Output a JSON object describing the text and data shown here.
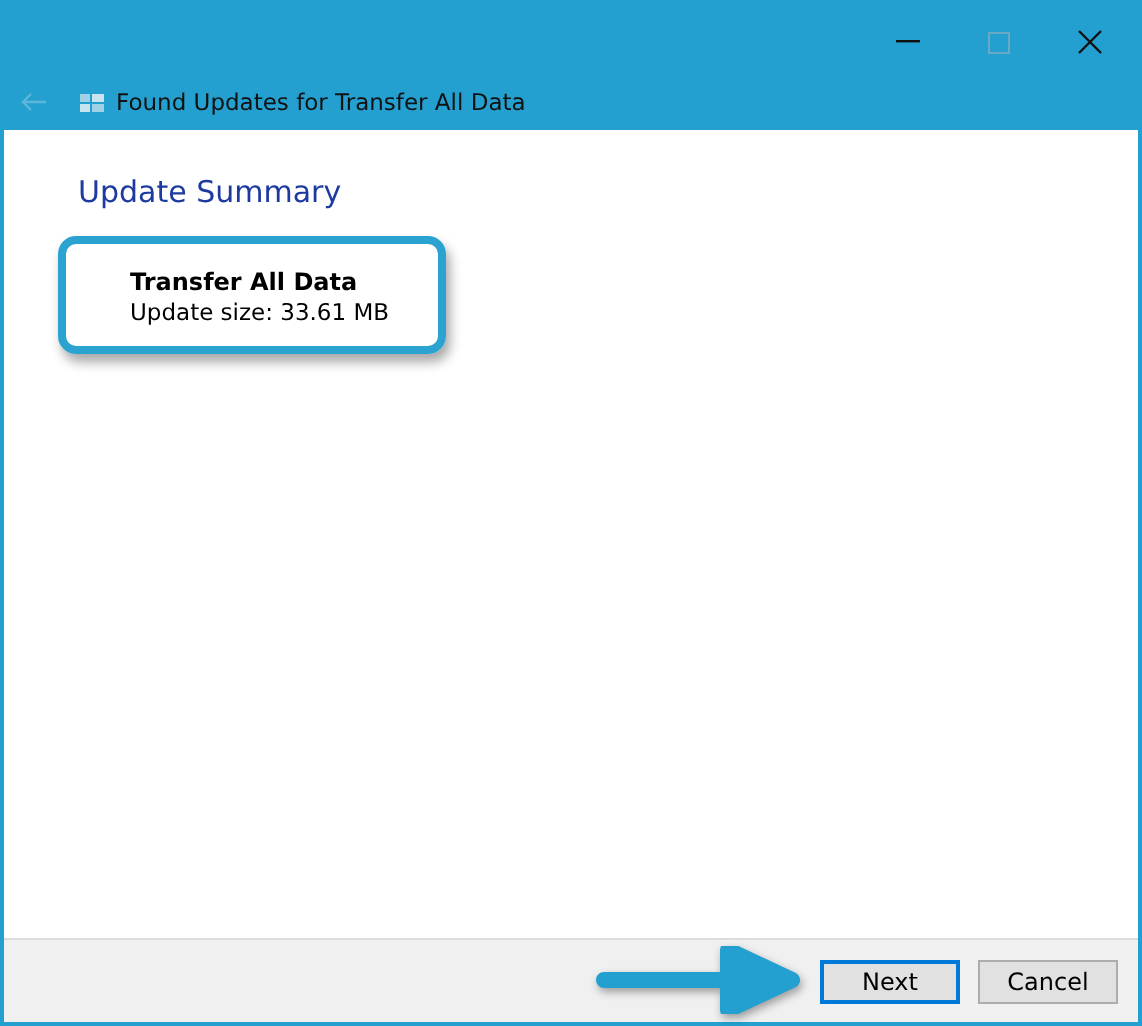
{
  "window": {
    "title": "Found Updates for Transfer All Data"
  },
  "heading": "Update Summary",
  "update": {
    "name": "Transfer All Data",
    "size": "Update size: 33.61 MB"
  },
  "buttons": [
    {
      "label": "Next",
      "focused": true
    },
    {
      "label": "Cancel",
      "focused": false
    }
  ]
}
